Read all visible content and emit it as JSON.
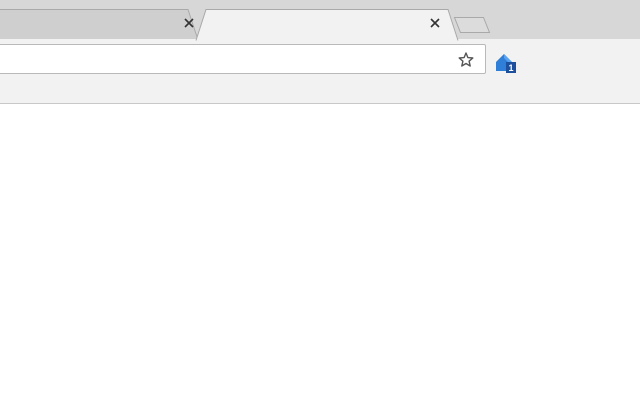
{
  "tabs": [
    {
      "title": "",
      "active": false
    },
    {
      "title": "",
      "active": true
    }
  ],
  "omnibox": {
    "value": "",
    "placeholder": ""
  },
  "extension": {
    "badge": "1"
  },
  "colors": {
    "tabstrip": "#d7d7d7",
    "toolbar": "#f2f2f2",
    "extension_blue": "#2f7fd8",
    "extension_dark": "#1d4f9c"
  },
  "icons": {
    "tab_close": "close-icon",
    "bookmark": "star-icon",
    "extension": "house-badge-icon"
  }
}
